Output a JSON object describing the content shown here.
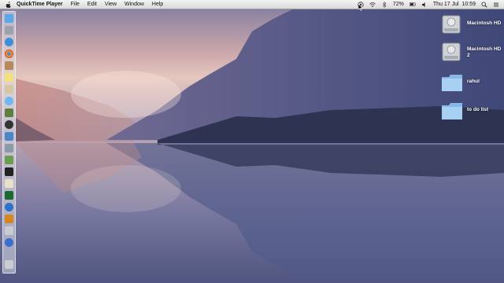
{
  "menubar": {
    "app_name": "QuickTime Player",
    "menus": [
      "File",
      "Edit",
      "View",
      "Window",
      "Help"
    ],
    "status": {
      "battery": "72%",
      "date_time": "Thu 17 Jul  10:59"
    }
  },
  "desktop": {
    "icons": [
      {
        "label": "Macintosh HD",
        "icon": "hard-drive-icon"
      },
      {
        "label": "Macintosh HD 2",
        "icon": "hard-drive-icon"
      },
      {
        "label": "rahul",
        "icon": "folder-icon"
      },
      {
        "label": "to do list",
        "icon": "folder-icon"
      }
    ]
  },
  "dock": {
    "icons": [
      "finder-icon",
      "launchpad-icon",
      "safari-icon",
      "chrome-icon",
      "contacts-icon",
      "notes-icon",
      "mail-icon",
      "messages-icon",
      "facetime-icon",
      "camera-icon",
      "itunes-icon",
      "system-preferences-icon",
      "photo-icon",
      "terminal-icon",
      "app-icon",
      "app-icon",
      "quicktime-icon",
      "app-icon",
      "app-icon",
      "downloads-icon",
      "trash-icon"
    ]
  }
}
